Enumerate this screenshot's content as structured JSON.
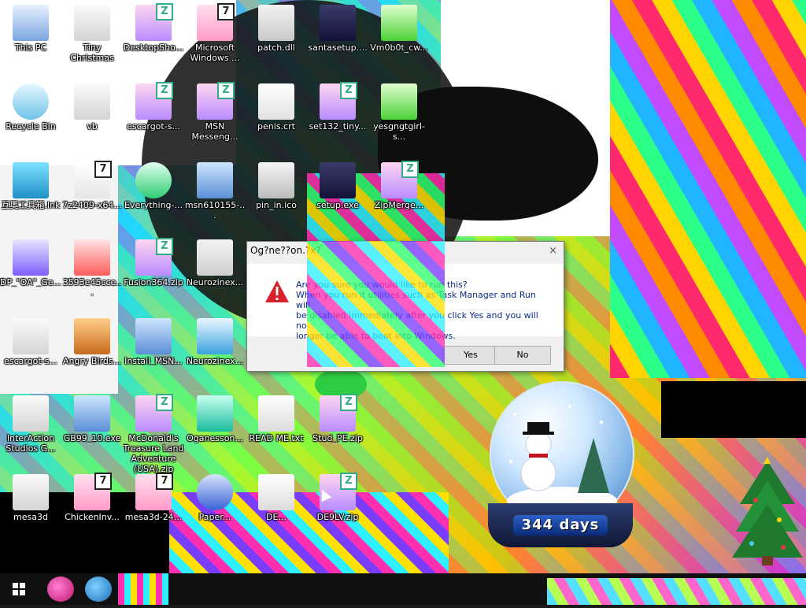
{
  "desktop": {
    "icons": [
      {
        "label": "This PC",
        "icon": "computer-icon"
      },
      {
        "label": "Tiny Christmas",
        "icon": "folder-icon"
      },
      {
        "label": "DesktopSho...",
        "icon": "zip-icon"
      },
      {
        "label": "Microsoft Windows ...",
        "icon": "7z-icon"
      },
      {
        "label": "patch.dll",
        "icon": "dll-icon"
      },
      {
        "label": "santasetup....",
        "icon": "setup-icon"
      },
      {
        "label": "Vm0b0t_cw...",
        "icon": "image-icon"
      },
      {
        "label": "Recycle Bin",
        "icon": "recycle-bin-icon"
      },
      {
        "label": "vb",
        "icon": "folder-icon"
      },
      {
        "label": "escargot-s...",
        "icon": "zip-icon"
      },
      {
        "label": "MSN Messeng...",
        "icon": "zip-icon"
      },
      {
        "label": "penis.crt",
        "icon": "certificate-icon"
      },
      {
        "label": "set132_tiny...",
        "icon": "zip-icon"
      },
      {
        "label": "yesgngtgirl-s...",
        "icon": "image-icon"
      },
      {
        "label": "互奧工具箱.lnk",
        "icon": "app-icon"
      },
      {
        "label": "7z2409-x64...",
        "icon": "7z-installer-icon"
      },
      {
        "label": "Everything-...",
        "icon": "search-app-icon"
      },
      {
        "label": "msn610155-...",
        "icon": "installer-icon"
      },
      {
        "label": "pin_in.ico",
        "icon": "ico-file-icon"
      },
      {
        "label": "setup.exe",
        "icon": "setup-icon"
      },
      {
        "label": "ZipMerge...",
        "icon": "zip-icon"
      },
      {
        "label": "DP_\"OA\"_Ge...",
        "icon": "gear-icon"
      },
      {
        "label": "3593e45cce...",
        "icon": "pdf-icon"
      },
      {
        "label": "Fusion364.zip",
        "icon": "zip-icon"
      },
      {
        "label": "Neurozinex...",
        "icon": "binary-file-icon"
      },
      {
        "label": "escargot-s...",
        "icon": "folder-icon"
      },
      {
        "label": "Angry Birds...",
        "icon": "game-icon"
      },
      {
        "label": "Install_MSN...",
        "icon": "installer-icon"
      },
      {
        "label": "Neurozinex...",
        "icon": "window-app-icon"
      },
      {
        "label": "InterAction Studios G...",
        "icon": "folder-icon"
      },
      {
        "label": "GB99_10.exe",
        "icon": "installer-icon"
      },
      {
        "label": "McDonald's Treasure Land Adventure (USA).zip",
        "icon": "zip-icon"
      },
      {
        "label": "Oganesson...",
        "icon": "og-app-icon"
      },
      {
        "label": "READ ME.txt",
        "icon": "text-file-icon"
      },
      {
        "label": "Stud_PE.zip",
        "icon": "zip-icon"
      },
      {
        "label": "mesa3d",
        "icon": "folder-icon"
      },
      {
        "label": "ChickenInv...",
        "icon": "7z-icon"
      },
      {
        "label": "mesa3d-24...",
        "icon": "7z-icon"
      },
      {
        "label": "Paper...",
        "icon": "disc-icon"
      },
      {
        "label": "DE...",
        "icon": "text-file-icon"
      },
      {
        "label": "DE9LV.zip",
        "icon": "zip-icon"
      }
    ]
  },
  "dialog": {
    "title": "Og?ne??on.?x?",
    "close": "×",
    "line1": "Are you sure you would like to run this?",
    "line2": "When you run it utilities such as Task Manager and Run will",
    "line3": "be disabled immediately after you click Yes and you will no",
    "line4": "longer be able to boot into Windows.",
    "yes_label": "Yes",
    "no_label": "No"
  },
  "snowglobe": {
    "days_label": "344 days"
  },
  "taskbar": {
    "start_icon": "windows-logo-icon",
    "apps": [
      "pink-app-icon",
      "blue-app-icon"
    ]
  }
}
